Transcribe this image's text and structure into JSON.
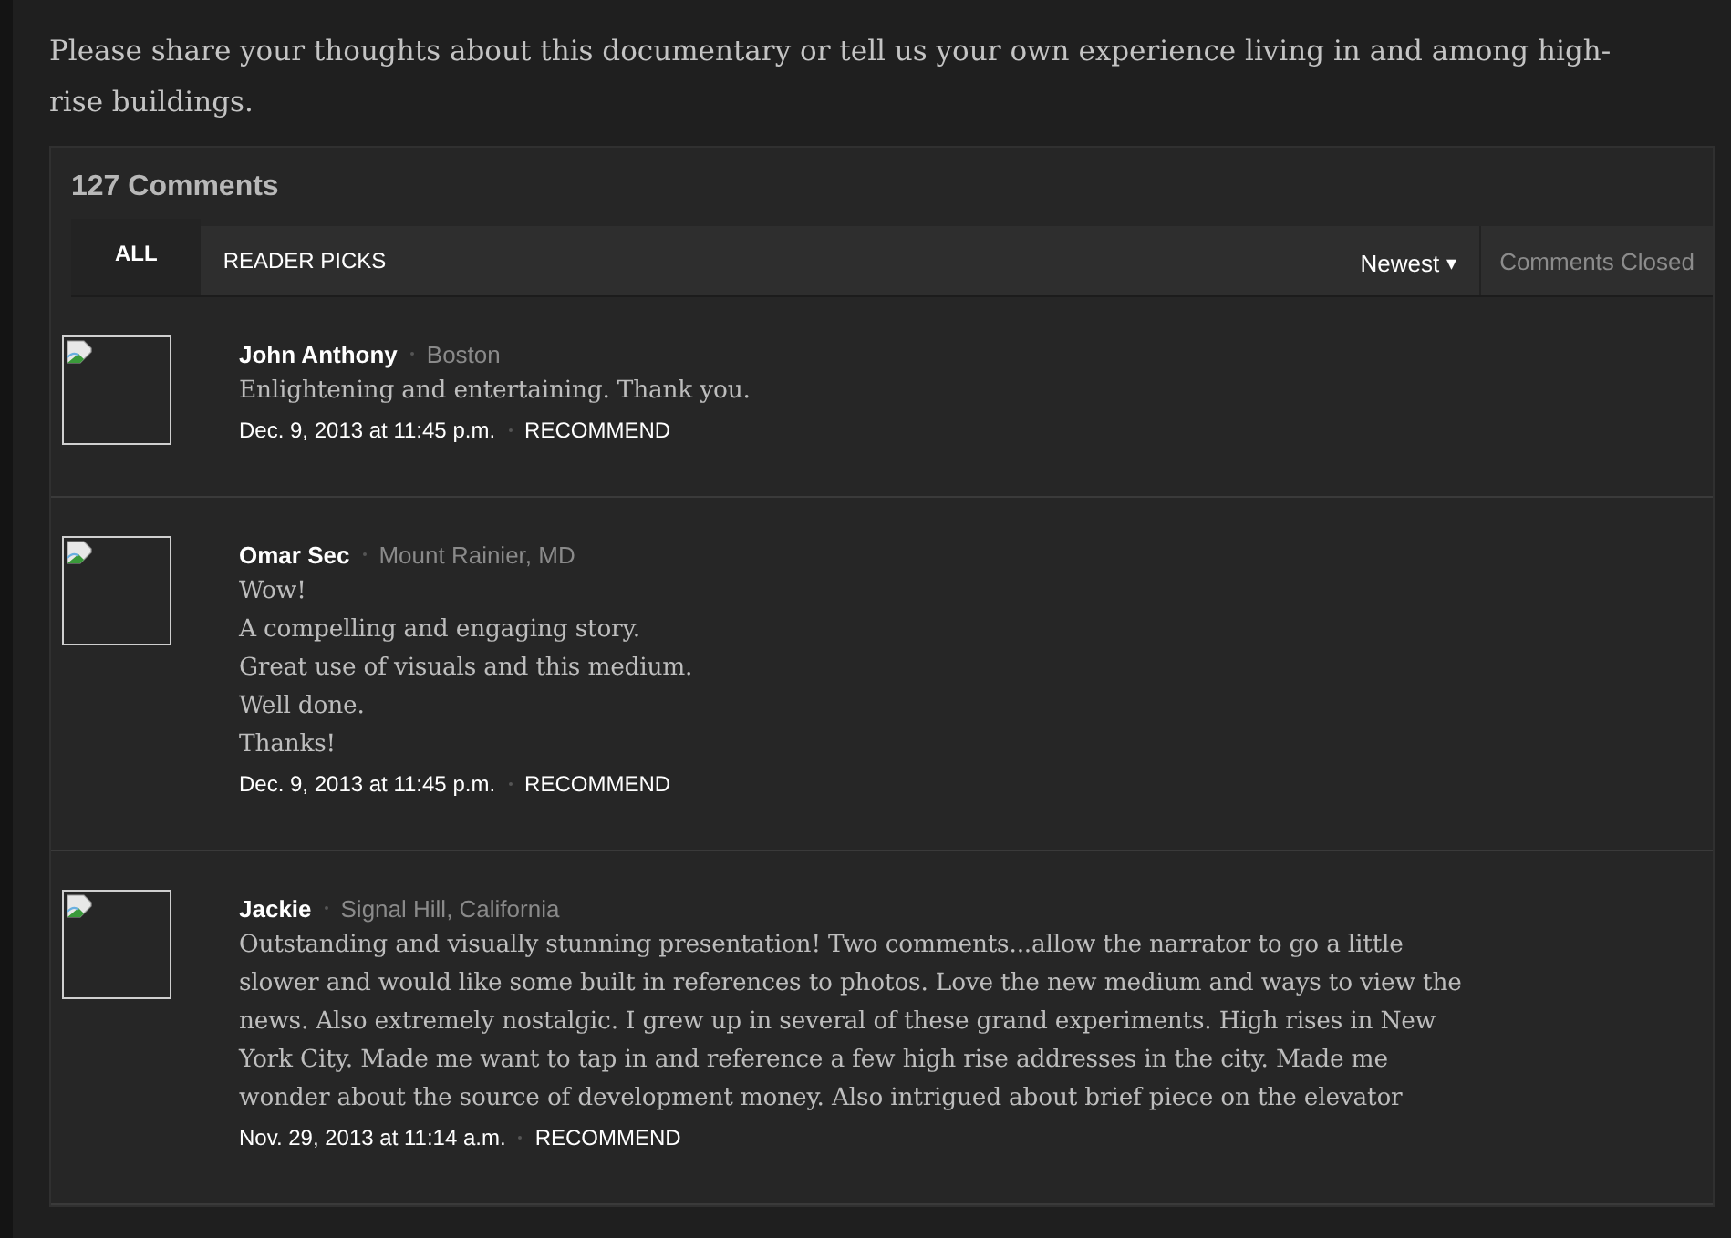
{
  "intro": "Please share your thoughts about this documentary or tell us your own experience living in and among high-rise buildings.",
  "comments_header": {
    "count": "127 Comments"
  },
  "tabs": [
    {
      "label": "ALL",
      "selected": true
    },
    {
      "label": "READER PICKS",
      "selected": false
    }
  ],
  "sort": {
    "label": "Newest",
    "caret": "▾"
  },
  "status": "Comments Closed",
  "comments": [
    {
      "author": "John Anthony",
      "location": "Boston",
      "lines": [
        "Enlightening and entertaining. Thank you."
      ],
      "date": "Dec. 9, 2013 at 11:45 p.m.",
      "action": "RECOMMEND"
    },
    {
      "author": "Omar Sec",
      "location": "Mount Rainier, MD",
      "lines": [
        "Wow!",
        "A compelling and engaging story.",
        "Great use of visuals and this medium.",
        "Well done.",
        "Thanks!"
      ],
      "date": "Dec. 9, 2013 at 11:45 p.m.",
      "action": "RECOMMEND"
    },
    {
      "author": "Jackie",
      "location": "Signal Hill, California",
      "lines": [
        "Outstanding and visually stunning presentation! Two comments...allow the narrator to go a little slower and would like some built in references to photos. Love the new medium and ways to view the news. Also extremely nostalgic. I grew up in several of these grand experiments. High rises in New York City. Made me want to tap in and reference a few high rise addresses in the city. Made me wonder about the source of development money. Also intrigued about brief piece on the elevator"
      ],
      "date": "Nov. 29, 2013 at 11:14 a.m.",
      "action": "RECOMMEND"
    }
  ]
}
